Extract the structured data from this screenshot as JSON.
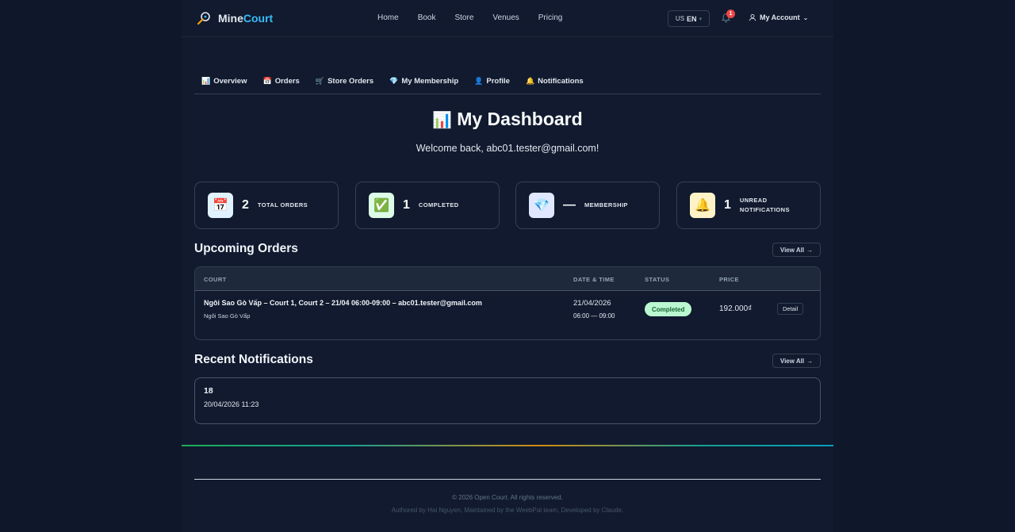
{
  "brand": {
    "part1": "Mine",
    "part2": "Court"
  },
  "nav": {
    "items": [
      "Home",
      "Book",
      "Store",
      "Venues",
      "Pricing"
    ]
  },
  "lang": {
    "flag": "US",
    "code": "EN"
  },
  "notifications_badge": "1",
  "account": {
    "label": "My Account"
  },
  "tabs": [
    {
      "icon": "📊",
      "label": "Overview"
    },
    {
      "icon": "📅",
      "label": "Orders"
    },
    {
      "icon": "🛒",
      "label": "Store Orders"
    },
    {
      "icon": "💎",
      "label": "My Membership"
    },
    {
      "icon": "👤",
      "label": "Profile"
    },
    {
      "icon": "🔔",
      "label": "Notifications"
    }
  ],
  "dashboard": {
    "title_icon": "📊",
    "title": "My Dashboard",
    "welcome": "Welcome back, abc01.tester@gmail.com!"
  },
  "stats": [
    {
      "icon": "📅",
      "value": "2",
      "label": "TOTAL ORDERS",
      "icon_bg": "#e0f2fe"
    },
    {
      "icon": "✅",
      "value": "1",
      "label": "COMPLETED",
      "icon_bg": "#dcfce7"
    },
    {
      "icon": "💎",
      "value": "—",
      "label": "MEMBERSHIP",
      "icon_bg": "#e0e7ff"
    },
    {
      "icon": "🔔",
      "value": "1",
      "label": "UNREAD NOTIFICATIONS",
      "icon_bg": "#fef3c7"
    }
  ],
  "upcoming": {
    "title": "Upcoming Orders",
    "view_all": "View All",
    "columns": {
      "court": "COURT",
      "datetime": "DATE & TIME",
      "status": "STATUS",
      "price": "PRICE"
    },
    "rows": [
      {
        "court": "Ngôi Sao Gò Vấp – Court 1, Court 2 – 21/04 06:00-09:00 – abc01.tester@gmail.com",
        "venue": "Ngôi Sao Gò Vấp",
        "date": "21/04/2026",
        "time": "06:00 — 09:00",
        "status": "Completed",
        "price": "192.000₫",
        "action": "Detail"
      }
    ]
  },
  "recent": {
    "title": "Recent Notifications",
    "view_all": "View All",
    "items": [
      {
        "title": "18",
        "time": "20/04/2026 11:23"
      }
    ]
  },
  "footer": {
    "copyright": "© 2026 Open Court. All rights reserved.",
    "credits": "Authored by Hai Nguyen, Maintained by the WeebPal team, Developed by Claude."
  },
  "colors": {
    "accent": "#38bdf8",
    "status_completed_bg": "#bbf7d0",
    "badge": "#ef4444"
  }
}
